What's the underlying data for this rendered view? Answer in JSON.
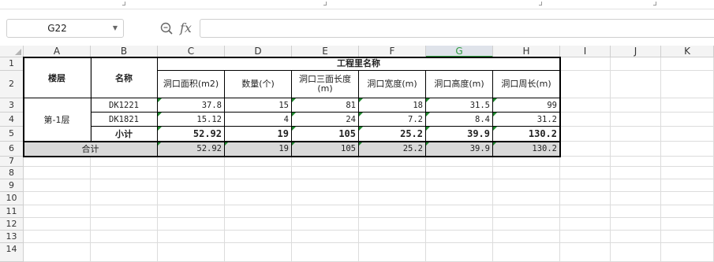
{
  "name_box": {
    "value": "G22"
  },
  "formula_bar": {
    "fx_label": "fx",
    "value": ""
  },
  "columns": [
    "A",
    "B",
    "C",
    "D",
    "E",
    "F",
    "G",
    "H",
    "I",
    "J",
    "K"
  ],
  "selected_column": "G",
  "rows": [
    "1",
    "2",
    "3",
    "4",
    "5",
    "6",
    "7",
    "8",
    "9",
    "10",
    "11",
    "12",
    "13",
    "14"
  ],
  "table": {
    "floor_header": "楼层",
    "name_header": "名称",
    "group_header": "工程里名称",
    "sub_headers": [
      "洞口面积(m2)",
      "数量(个)",
      "洞口三面长度(m)",
      "洞口宽度(m)",
      "洞口高度(m)",
      "洞口周长(m)"
    ],
    "floor_label": "第-1层",
    "data_rows": [
      {
        "name": "DK1221",
        "values": [
          "37.8",
          "15",
          "81",
          "18",
          "31.5",
          "99"
        ]
      },
      {
        "name": "DK1821",
        "values": [
          "15.12",
          "4",
          "24",
          "7.2",
          "8.4",
          "31.2"
        ]
      }
    ],
    "subtotal": {
      "name": "小计",
      "values": [
        "52.92",
        "19",
        "105",
        "25.2",
        "39.9",
        "130.2"
      ]
    },
    "total": {
      "label": "合计",
      "values": [
        "52.92",
        "19",
        "105",
        "25.2",
        "39.9",
        "130.2"
      ]
    }
  },
  "colors": {
    "accent": "#2e9b3e",
    "header_bg": "#f4f4f4",
    "total_bg": "#d9d9d9"
  }
}
